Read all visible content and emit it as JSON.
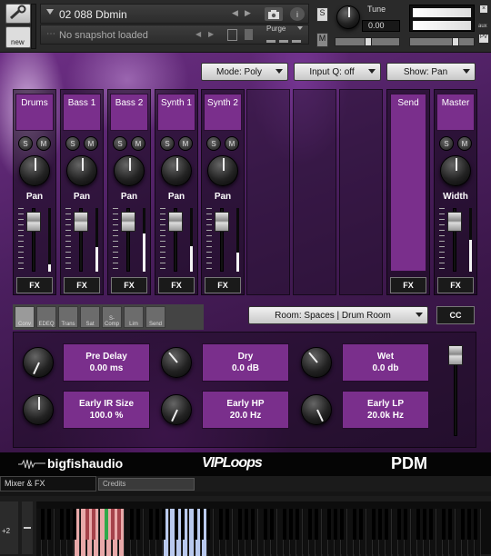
{
  "header": {
    "instrument_name": "02 088 Dbmin",
    "snapshot_placeholder": "No snapshot loaded",
    "purge_label": "Purge",
    "new_label": "new",
    "tune_label": "Tune",
    "tune_value": "0.00",
    "solo_label": "S",
    "mute_label": "M",
    "aux_label": "aux",
    "pv_label": "PV"
  },
  "controls": {
    "mode": "Mode: Poly",
    "input_q": "Input Q: off",
    "show": "Show: Pan"
  },
  "channels": [
    {
      "name": "Drums",
      "knob_label": "Pan",
      "s": "S",
      "m": "M",
      "fx": "FX",
      "meter": 0.12
    },
    {
      "name": "Bass 1",
      "knob_label": "Pan",
      "s": "S",
      "m": "M",
      "fx": "FX",
      "meter": 0.38
    },
    {
      "name": "Bass 2",
      "knob_label": "Pan",
      "s": "S",
      "m": "M",
      "fx": "FX",
      "meter": 0.6
    },
    {
      "name": "Synth 1",
      "knob_label": "Pan",
      "s": "S",
      "m": "M",
      "fx": "FX",
      "meter": 0.4
    },
    {
      "name": "Synth 2",
      "knob_label": "Pan",
      "s": "S",
      "m": "M",
      "fx": "FX",
      "meter": 0.3
    }
  ],
  "send": {
    "name": "Send",
    "fx": "FX"
  },
  "master": {
    "name": "Master",
    "knob_label": "Width",
    "s": "S",
    "m": "M",
    "fx": "FX",
    "meter": 0.5
  },
  "effects_tabs": [
    "Conv",
    "EDEQ",
    "Trans",
    "Sat",
    "S-Comp",
    "Lim",
    "Send"
  ],
  "room_preset": "Room: Spaces | Drum Room",
  "cc_label": "CC",
  "params": [
    {
      "name": "Pre Delay",
      "value": "0.00 ms"
    },
    {
      "name": "Dry",
      "value": "0.0 dB"
    },
    {
      "name": "Wet",
      "value": "0.0 db"
    },
    {
      "name": "Early IR Size",
      "value": "100.0 %"
    },
    {
      "name": "Early HP",
      "value": "20.0 Hz"
    },
    {
      "name": "Early LP",
      "value": "20.0k Hz"
    }
  ],
  "brands": {
    "left": "bigfishaudio",
    "center": "VIPLoops",
    "right": "PDM"
  },
  "bottom_tabs": [
    "Mixer & FX",
    "Credits"
  ],
  "keyboard": {
    "octave": "+2"
  },
  "colors": {
    "accent": "#7a2f8c",
    "panel": "#2a2a2a"
  }
}
